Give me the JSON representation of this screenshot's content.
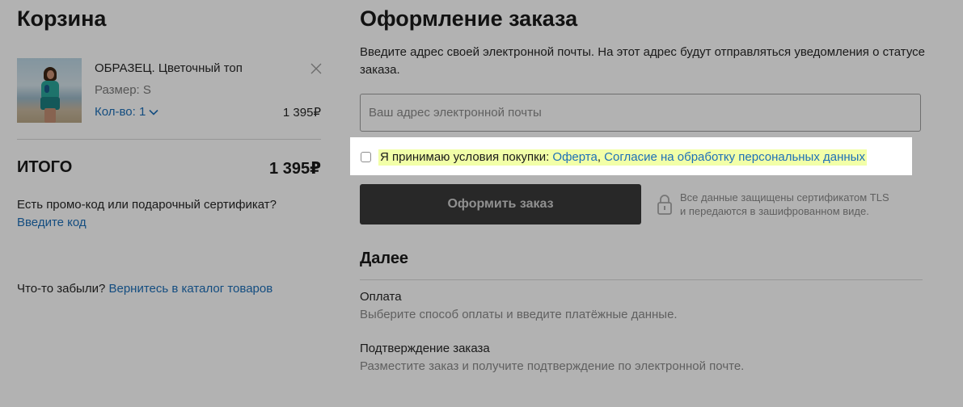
{
  "cart": {
    "title": "Корзина",
    "item": {
      "name": "ОБРАЗЕЦ. Цветочный топ",
      "size": "Размер: S",
      "qty": "Кол-во: 1",
      "price": "1 395₽",
      "thumb": "woman-beach-photo"
    },
    "total_label": "ИТОГО",
    "total_value": "1 395₽",
    "promo_text": "Есть промо-код или подарочный сертификат?",
    "promo_link": "Введите код",
    "forgot_text": "Что-то забыли? ",
    "forgot_link": "Вернитесь в каталог товаров"
  },
  "checkout": {
    "title": "Оформление заказа",
    "email_hint": "Введите адрес своей электронной почты. На этот адрес будут отправляться уведомления о статусе заказа.",
    "email_placeholder": "Ваш адрес электронной почты",
    "email_value": "",
    "agree_prefix": "Я принимаю условия покупки: ",
    "agree_link_offer": "Оферта",
    "agree_separator": ", ",
    "agree_link_consent": "Согласие на обработку персональных данных",
    "submit_label": "Оформить заказ",
    "tls_line1": "Все данные защищены сертификатом TLS",
    "tls_line2": "и передаются в зашифрованном виде.",
    "next_title": "Далее",
    "steps": [
      {
        "title": "Оплата",
        "desc": "Выберите способ оплаты и введите платёжные данные."
      },
      {
        "title": "Подтверждение заказа",
        "desc": "Разместите заказ и получите подтверждение по электронной почте."
      }
    ]
  },
  "colors": {
    "link": "#1d6fb8",
    "highlight": "#f2ffa8",
    "button": "#3a3a3a",
    "overlay": "rgba(0,0,0,0.3)"
  },
  "icons": [
    "close-icon",
    "chevron-down-icon",
    "lock-icon"
  ]
}
